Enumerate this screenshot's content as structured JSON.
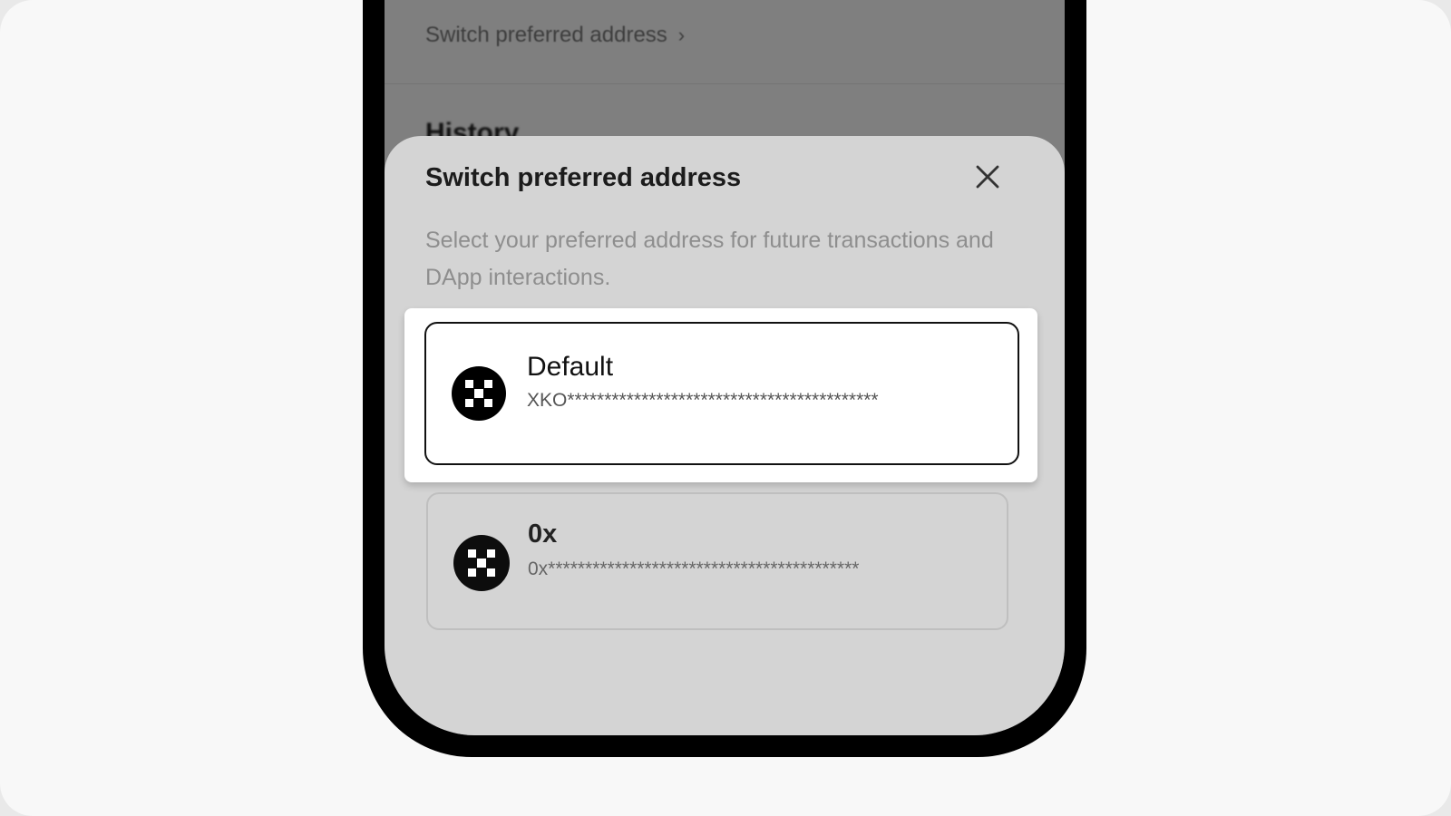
{
  "background_screen": {
    "switch_link": "Switch preferred address",
    "switch_chevron": "›",
    "history_heading": "History"
  },
  "sheet": {
    "title": "Switch preferred address",
    "close_icon": "close-icon",
    "description": "Select your preferred address for future transactions and DApp interactions."
  },
  "options": [
    {
      "name": "Default",
      "address": "XKO******************************************",
      "icon": "okx-logo",
      "selected": true
    },
    {
      "name": "0x",
      "address": "0x******************************************",
      "icon": "okx-logo",
      "selected": false
    }
  ],
  "colors": {
    "overlay": "#7f7f7f",
    "sheet": "#d4d4d4",
    "highlight": "#ffffff",
    "logo": "#000000"
  }
}
